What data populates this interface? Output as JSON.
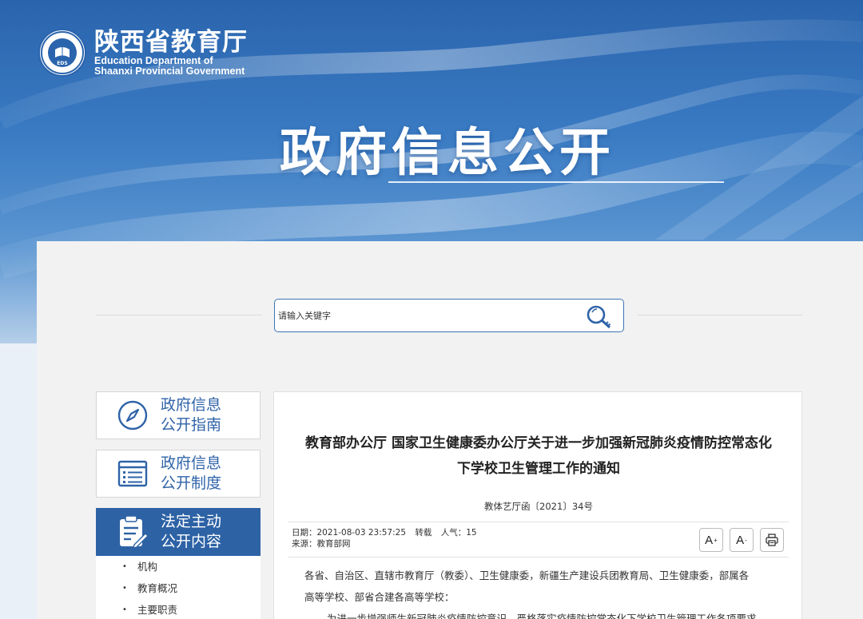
{
  "header": {
    "org_name_cn": "陕西省教育厅",
    "org_name_en_line1": "Education Department of",
    "org_name_en_line2": "Shaanxi Provincial Government",
    "page_title": "政府信息公开"
  },
  "search": {
    "placeholder": "请输入关键字",
    "icon": "search-key-icon"
  },
  "sidebar": {
    "cards": [
      {
        "label_line1": "政府信息",
        "label_line2": "公开指南",
        "icon": "compass-icon",
        "active": false
      },
      {
        "label_line1": "政府信息",
        "label_line2": "公开制度",
        "icon": "list-document-icon",
        "active": false
      },
      {
        "label_line1": "法定主动",
        "label_line2": "公开内容",
        "icon": "clipboard-edit-icon",
        "active": true
      }
    ],
    "items": [
      {
        "label": "机构"
      },
      {
        "label": "教育概况"
      },
      {
        "label": "主要职责"
      }
    ]
  },
  "article": {
    "title_line1": "教育部办公厅 国家卫生健康委办公厅关于进一步加强新冠肺炎疫情防控常态化",
    "title_line2": "下学校卫生管理工作的通知",
    "doc_number": "教体艺厅函〔2021〕34号",
    "meta": {
      "date": "日期：2021-08-03 23:57:25",
      "repost": "转载",
      "views": "人气：15",
      "source": "来源：教育部网"
    },
    "tools": {
      "font_increase": "A",
      "font_decrease": "A",
      "print_icon": "print-icon"
    },
    "body": {
      "para1_line1": "各省、自治区、直辖市教育厅（教委）、卫生健康委，新疆生产建设兵团教育局、卫生健康委，部属各",
      "para1_line2": "高等学校、部省合建各高等学校：",
      "para2_line1": "为进一步增强师生新冠肺炎疫情防控意识，严格落实疫情防控常态化下学校卫生管理工作各项要求"
    }
  },
  "colors": {
    "brand_blue": "#2d62a5",
    "link_blue": "#2f63a8",
    "panel_bg": "#f2f2f2"
  }
}
